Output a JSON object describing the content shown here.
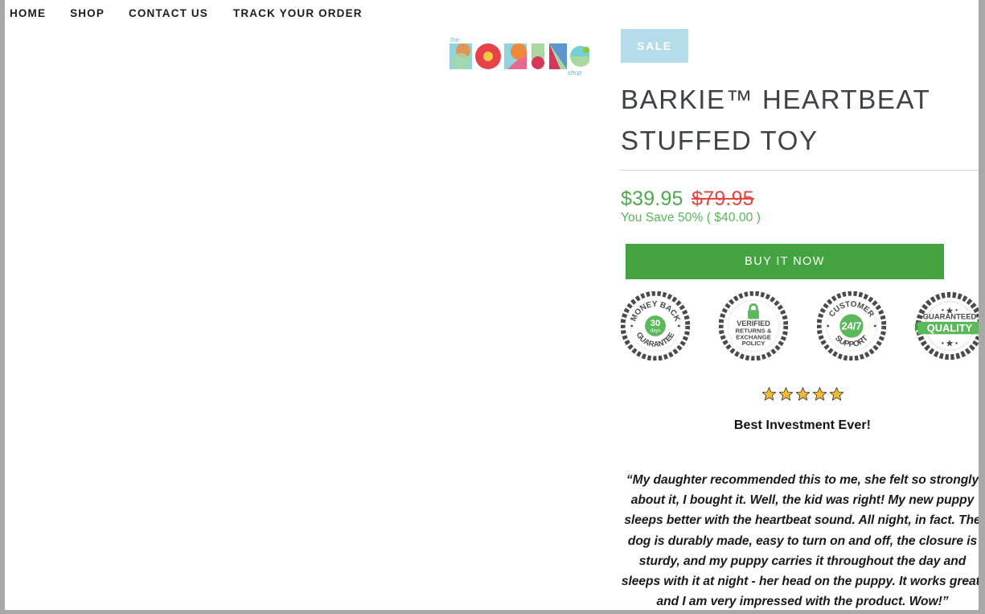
{
  "nav": {
    "items": [
      {
        "label": "HOME",
        "name": "nav-item-home"
      },
      {
        "label": "SHOP",
        "name": "nav-item-shop"
      },
      {
        "label": "CONTACT US",
        "name": "nav-item-contact-us"
      },
      {
        "label": "TRACK YOUR ORDER",
        "name": "nav-item-track-your-order"
      }
    ]
  },
  "logo": {
    "top_word": "the",
    "main_word": "BORING",
    "bottom_word": "shop",
    "colors": {
      "teal": "#76cfd6",
      "light_blue": "#8fd4e0",
      "red": "#e8414a",
      "pink": "#e8698f",
      "orange": "#f0883c",
      "yellow": "#f7c843",
      "mint": "#a8d8a0",
      "blue": "#5b96d1",
      "crimson": "#d6355c",
      "green": "#8cc63f"
    }
  },
  "product": {
    "badge": "SALE",
    "badge_color": "#b4dce9",
    "title": "BARKIE™ HEARTBEAT STUFFED TOY",
    "price_sale": "$39.95",
    "price_compare": "$79.95",
    "price_save": "You Save 50% ( $40.00 )",
    "price_sale_color": "#4ea94e",
    "price_compare_color": "#e8433f",
    "buy_label": "BUY IT NOW",
    "buy_color": "#44a340"
  },
  "trust_badges": [
    {
      "name": "money-back-guarantee-badge",
      "arc_top": "MONEY BACK",
      "arc_bottom": "GUARANTEE",
      "center_line1": "30",
      "center_line2": "days"
    },
    {
      "name": "verified-returns-policy-badge",
      "icon": "lock-icon",
      "lines": [
        "VERIFIED",
        "RETURNS &",
        "EXCHANGE",
        "POLICY"
      ]
    },
    {
      "name": "customer-support-badge",
      "arc_top": "CUSTOMER",
      "arc_bottom": "SUPPORT",
      "center_line1": "24/7"
    },
    {
      "name": "guaranteed-quality-badge",
      "line_top": "GUARANTEED",
      "ribbon": "QUALITY"
    }
  ],
  "review": {
    "stars": 5,
    "star_glyph": "★",
    "star_color": "#f7b731",
    "heading": "Best Investment Ever!",
    "body": "“My daughter recommended this to me, she felt so strongly about it, I bought it. Well, the kid was right! My new puppy sleeps better with the heartbeat sound. All night, in fact. The dog is durably made, easy to turn on and off, the closure is sturdy, and my puppy carries it throughout the day and sleeps with it at night - her head on the puppy. It works great, and I am very impressed with the product. Wow!”"
  }
}
